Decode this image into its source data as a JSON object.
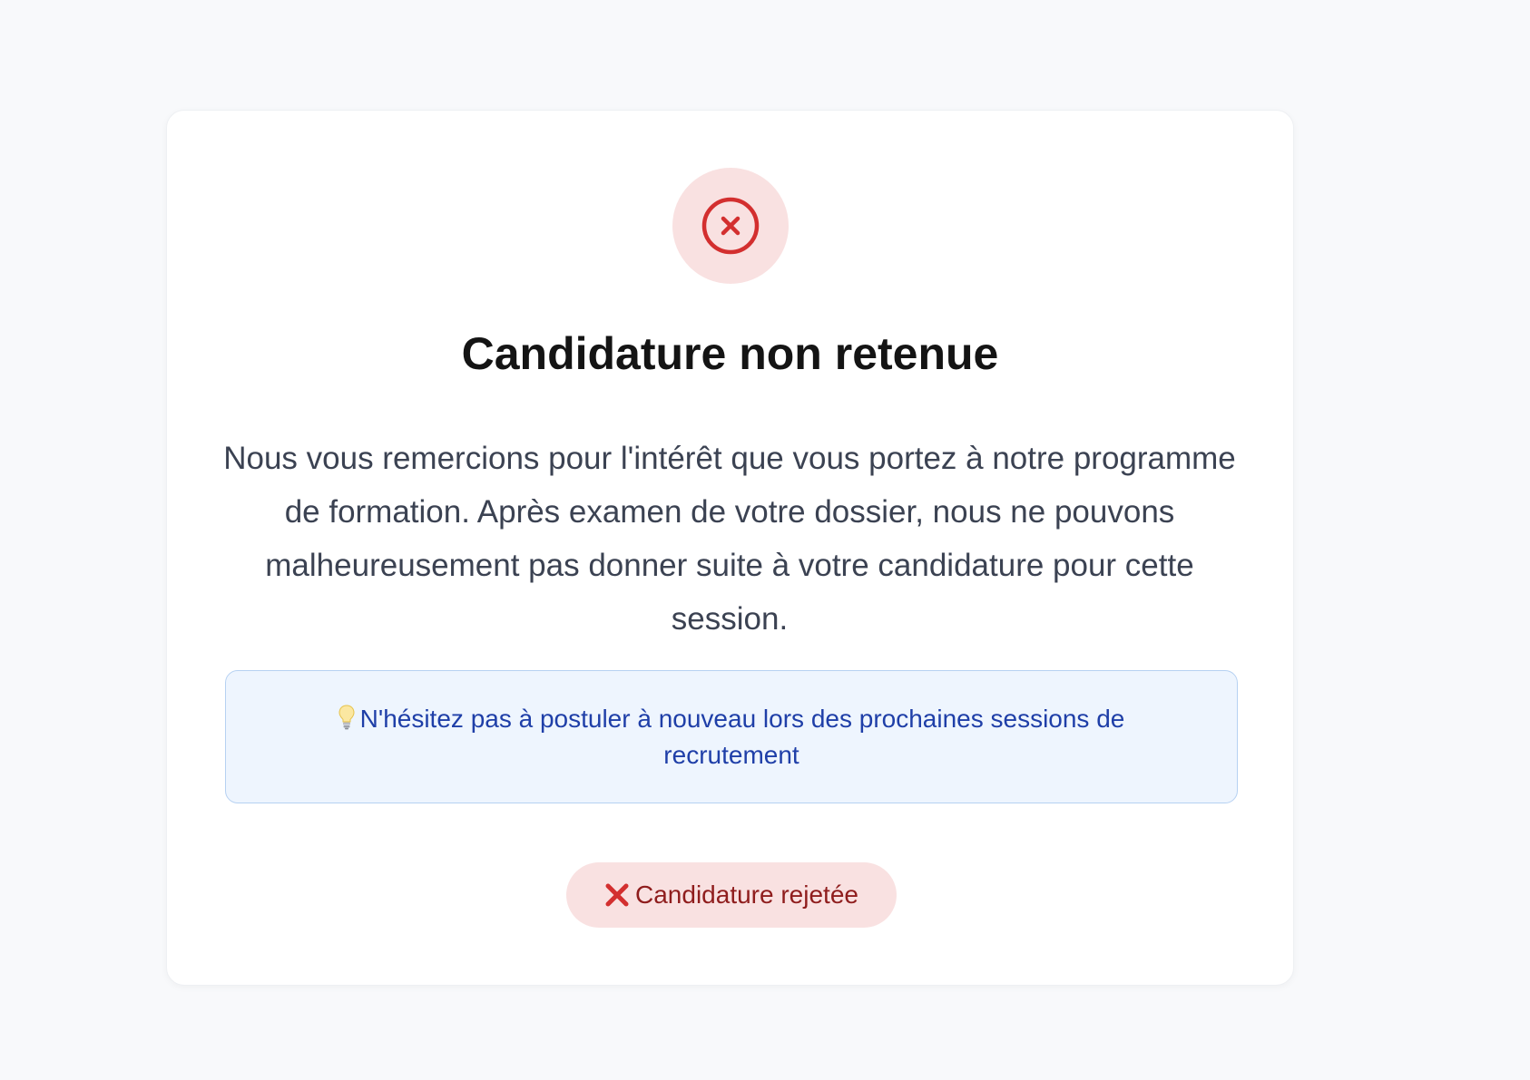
{
  "card": {
    "title": "Candidature non retenue",
    "message": "Nous vous remercions pour l'intérêt que vous portez à notre programme de formation. Après examen de votre dossier, nous ne pouvons malheureusement pas donner suite à votre candidature pour cette session.",
    "header_icon": "x-circle-icon",
    "info": {
      "icon": "lightbulb-icon",
      "text": "N'hésitez pas à postuler à nouveau lors des prochaines sessions de recrutement"
    },
    "status_badge": {
      "icon": "cross-mark-icon",
      "label": "Candidature rejetée"
    }
  },
  "colors": {
    "page_background": "#f8f9fb",
    "card_background": "#ffffff",
    "danger": "#d32f2f",
    "danger_soft": "#f9e1e1",
    "danger_text": "#8f1d1d",
    "info_background": "#eef5fe",
    "info_border": "#b6d1f2",
    "info_text": "#1f3fa8",
    "title_text": "#141414",
    "body_text": "#3b4252"
  }
}
